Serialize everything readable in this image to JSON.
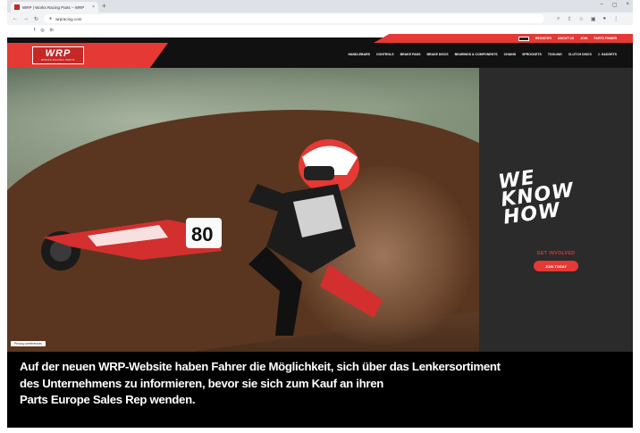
{
  "browser": {
    "tab_title": "WRP | Works Racing Parts – WRP",
    "tab_close": "×",
    "new_tab": "+",
    "url": "wrpracing.com",
    "window_controls": [
      "–",
      "▢",
      "×"
    ]
  },
  "site": {
    "social": [
      "f",
      "◎",
      "in"
    ],
    "utility_nav": [
      "REGISTER",
      "ABOUT US",
      "JOIN",
      "PARTS FINDER"
    ],
    "logo_text": "WRP",
    "logo_subtext": "WORKS RACING PARTS",
    "main_nav": [
      "HANDLEBARS",
      "CONTROLS",
      "BRAKE PADS",
      "BRAKE DISCS",
      "BEARINGS & COMPONENTS",
      "CHAINS",
      "SPROCKETS",
      "TOOLING",
      "CLUTCH DISCS",
      "J. GADGETS"
    ],
    "privacy_label": "Privacy preferences",
    "promo": {
      "slogan_lines": [
        "WE",
        "KNOW",
        "HOW"
      ],
      "subtitle": "GET INVOLVED",
      "button": "JOIN TODAY"
    },
    "accent_color": "#e53935"
  },
  "caption": {
    "lines": [
      "Auf der neuen WRP-Website haben Fahrer die Möglichkeit, sich über das Lenkersortiment",
      "des Unternehmens zu informieren, bevor sie sich zum Kauf an ihren",
      "Parts Europe Sales Rep wenden."
    ]
  }
}
